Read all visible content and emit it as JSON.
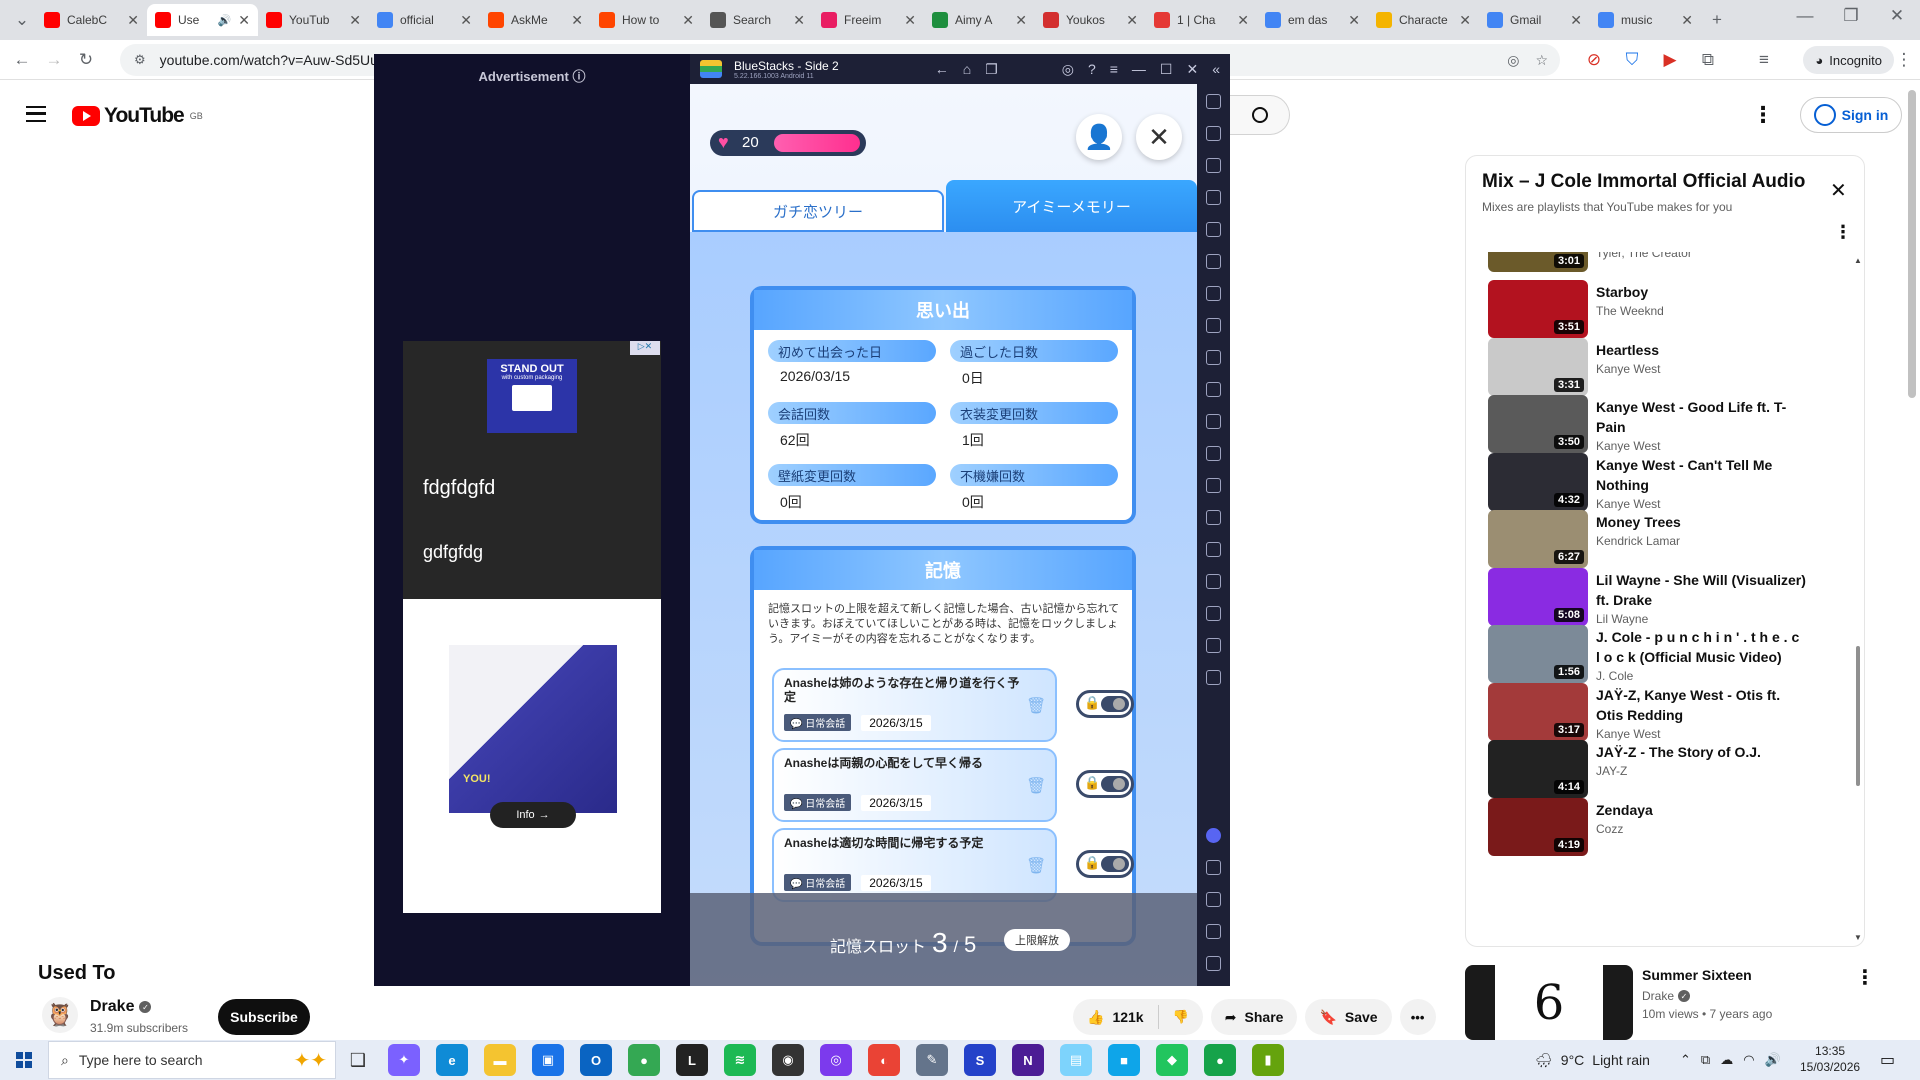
{
  "browser": {
    "tabs": [
      {
        "label": "CalebC",
        "color": "#ff0000",
        "icon": "youtube-icon"
      },
      {
        "label": "Use",
        "color": "#ff0000",
        "icon": "youtube-icon",
        "active": true
      },
      {
        "label": "YouTub",
        "color": "#ff0000",
        "icon": "youtube-icon"
      },
      {
        "label": "official",
        "color": "#4285f4",
        "icon": "google-docs-icon"
      },
      {
        "label": "AskMe",
        "color": "#ff4500",
        "icon": "reddit-icon"
      },
      {
        "label": "How to",
        "color": "#ff4500",
        "icon": "reddit-icon"
      },
      {
        "label": "Search",
        "color": "#555555",
        "icon": "search-icon"
      },
      {
        "label": "Freeim",
        "color": "#e91e63",
        "icon": "image-icon"
      },
      {
        "label": "Aimy A",
        "color": "#1e8e3e",
        "icon": "aimy-icon"
      },
      {
        "label": "Youkos",
        "color": "#d32f2f",
        "icon": "shoe-icon"
      },
      {
        "label": "1 | Cha",
        "color": "#e53935",
        "icon": "hand-icon"
      },
      {
        "label": "em das",
        "color": "#4285f4",
        "icon": "google-icon"
      },
      {
        "label": "Characte",
        "color": "#f4b400",
        "icon": "character-icon"
      },
      {
        "label": "Gmail",
        "color": "#4285f4",
        "icon": "google-icon"
      },
      {
        "label": "music",
        "color": "#4285f4",
        "icon": "google-icon"
      }
    ],
    "url": "youtube.com/watch?v=Auw-Sd5Uu",
    "incognito_label": "Incognito"
  },
  "youtube": {
    "logo_text": "YouTube",
    "region": "GB",
    "signin_label": "Sign in",
    "video_title": "Used To",
    "channel": "Drake",
    "subscribers": "31.9m subscribers",
    "subscribe_label": "Subscribe",
    "likes": "121k",
    "share_label": "Share",
    "save_label": "Save",
    "playlist": {
      "title": "Mix – J Cole Immortal Official Audio",
      "subtitle": "Mixes are playlists that YouTube makes for you",
      "partial_artist": "Tyler, The Creator",
      "items": [
        {
          "title": "Starboy",
          "artist": "The Weeknd",
          "duration": "3:51",
          "color": "#b3121f"
        },
        {
          "title": "Heartless",
          "artist": "Kanye West",
          "duration": "3:31",
          "color": "#c9c9c9"
        },
        {
          "title": "Kanye West - Good Life ft. T-Pain",
          "artist": "Kanye West",
          "duration": "3:50",
          "color": "#5a5a5a"
        },
        {
          "title": "Kanye West - Can't Tell Me Nothing",
          "artist": "Kanye West",
          "duration": "4:32",
          "color": "#2c2c34"
        },
        {
          "title": "Money Trees",
          "artist": "Kendrick Lamar",
          "duration": "6:27",
          "color": "#9b8e72"
        },
        {
          "title": "Lil Wayne - She Will (Visualizer) ft. Drake",
          "artist": "Lil Wayne",
          "duration": "5:08",
          "color": "#8a2be2"
        },
        {
          "title": "J. Cole - p u n c h i n ' . t h e . c l o c k (Official Music Video)",
          "artist": "J. Cole",
          "duration": "1:56",
          "color": "#7c8a98"
        },
        {
          "title": "JAŸ-Z, Kanye West - Otis ft. Otis Redding",
          "artist": "Kanye West",
          "duration": "3:17",
          "color": "#a33a3a"
        },
        {
          "title": "JAŸ-Z - The Story of O.J.",
          "artist": "JAY-Z",
          "duration": "4:14",
          "color": "#222222"
        },
        {
          "title": "Zendaya",
          "artist": "Cozz",
          "duration": "4:19",
          "color": "#7a1a1a"
        }
      ],
      "partial_first_duration": "3:01"
    },
    "up_next": {
      "title": "Summer Sixteen",
      "channel": "Drake",
      "meta": "10m views • 7 years ago",
      "thumb_text": "6"
    }
  },
  "ad": {
    "label": "Advertisement",
    "banner_title": "STAND OUT",
    "banner_sub": "with custom packaging",
    "text1": "fdgfdgfd",
    "text2": "gdfgfdg",
    "info_label": "Info",
    "image_text": "YOU!"
  },
  "bluestacks": {
    "title": "BlueStacks - Side 2",
    "version": "5.22.166.1003  Android 11"
  },
  "game": {
    "hearts": "20",
    "tabs": [
      "ガチ恋ツリー",
      "アイミーメモリー"
    ],
    "memories_card": {
      "title": "思い出",
      "stats": [
        {
          "label": "初めて出会った日",
          "value": "2026/03/15"
        },
        {
          "label": "過ごした日数",
          "value": "0日"
        },
        {
          "label": "会話回数",
          "value": "62回"
        },
        {
          "label": "衣装変更回数",
          "value": "1回"
        },
        {
          "label": "壁紙変更回数",
          "value": "0回"
        },
        {
          "label": "不機嫌回数",
          "value": "0回"
        }
      ]
    },
    "memory_card": {
      "title": "記憶",
      "description": "記憶スロットの上限を超えて新しく記憶した場合、古い記憶から忘れていきます。おぼえていてほしいことがある時は、記憶をロックしましょう。アイミーがその内容を忘れることがなくなります。",
      "items": [
        {
          "text": "Anasheは姉のような存在と帰り道を行く予定",
          "tag": "日常会話",
          "date": "2026/3/15"
        },
        {
          "text": "Anasheは両親の心配をして早く帰る",
          "tag": "日常会話",
          "date": "2026/3/15"
        },
        {
          "text": "Anasheは適切な時間に帰宅する予定",
          "tag": "日常会話",
          "date": "2026/3/15"
        }
      ]
    },
    "slots": {
      "label": "記憶スロット",
      "current": "3",
      "sep": "/",
      "max": "5",
      "unlock_label": "上限解放"
    }
  },
  "taskbar": {
    "search_placeholder": "Type here to search",
    "weather_temp": "9°C",
    "weather_desc": "Light rain",
    "time": "13:35",
    "date": "15/03/2026",
    "apps": [
      {
        "name": "copilot",
        "color": "#7b61ff",
        "glyph": "✦"
      },
      {
        "name": "edge",
        "color": "#0f8bd6",
        "glyph": "e"
      },
      {
        "name": "files",
        "color": "#f4c430",
        "glyph": "▬"
      },
      {
        "name": "store",
        "color": "#1a73e8",
        "glyph": "▣"
      },
      {
        "name": "outlook",
        "color": "#0a64c2",
        "glyph": "O"
      },
      {
        "name": "chrome",
        "color": "#34a853",
        "glyph": "●"
      },
      {
        "name": "live",
        "color": "#222",
        "glyph": "L"
      },
      {
        "name": "spotify",
        "color": "#1db954",
        "glyph": "≋"
      },
      {
        "name": "app-dark",
        "color": "#333",
        "glyph": "◉"
      },
      {
        "name": "app-purple",
        "color": "#7c3aed",
        "glyph": "◎"
      },
      {
        "name": "chrome-alt",
        "color": "#ea4335",
        "glyph": "◐"
      },
      {
        "name": "app-feather",
        "color": "#64748b",
        "glyph": "✎"
      },
      {
        "name": "app-s",
        "color": "#2442c9",
        "glyph": "S"
      },
      {
        "name": "app-n",
        "color": "#4c1d95",
        "glyph": "N"
      },
      {
        "name": "app-notes",
        "color": "#7dd3fc",
        "glyph": "▤"
      },
      {
        "name": "app-blue",
        "color": "#0ea5e9",
        "glyph": "■"
      },
      {
        "name": "bluestacks",
        "color": "#22c55e",
        "glyph": "◆"
      },
      {
        "name": "chrome-active",
        "color": "#16a34a",
        "glyph": "●"
      },
      {
        "name": "app-green",
        "color": "#65a30d",
        "glyph": "▮"
      }
    ]
  }
}
